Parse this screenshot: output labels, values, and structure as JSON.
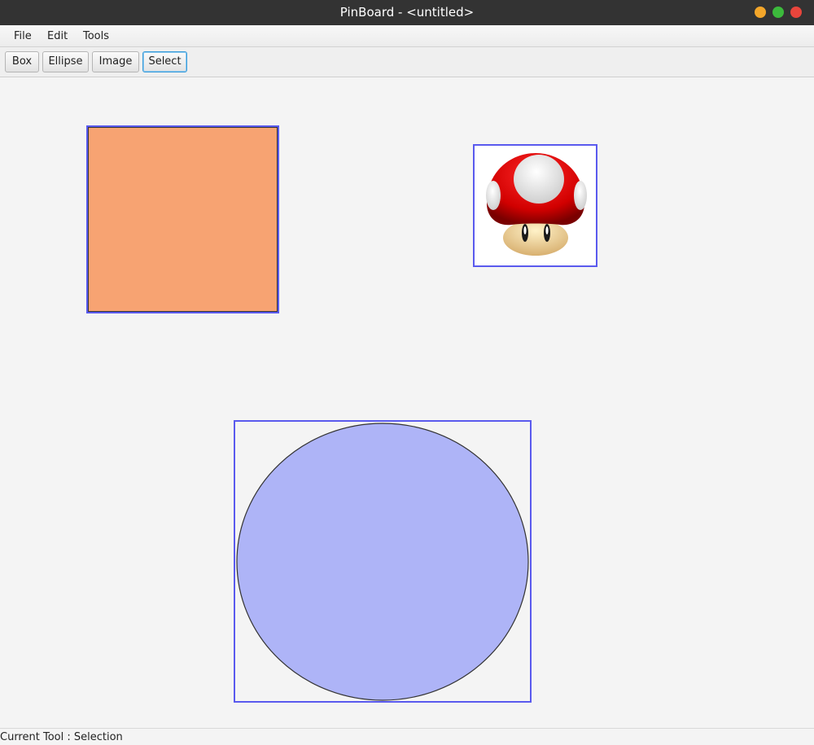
{
  "window": {
    "title": "PinBoard - <untitled>"
  },
  "menu": {
    "items": [
      {
        "label": "File"
      },
      {
        "label": "Edit"
      },
      {
        "label": "Tools"
      }
    ]
  },
  "toolbar": {
    "buttons": [
      {
        "label": "Box"
      },
      {
        "label": "Ellipse"
      },
      {
        "label": "Image"
      },
      {
        "label": "Select"
      }
    ],
    "active": "Select"
  },
  "canvas": {
    "shapes": [
      {
        "kind": "box",
        "fill": "#f7a372",
        "selected": true
      },
      {
        "kind": "image",
        "icon": "mushroom-icon",
        "selected": true
      },
      {
        "kind": "ellipse",
        "fill": "#aeb4f7",
        "selected": true
      }
    ],
    "selection_color": "#5a5aee"
  },
  "status": {
    "text": "Current Tool : Selection"
  }
}
